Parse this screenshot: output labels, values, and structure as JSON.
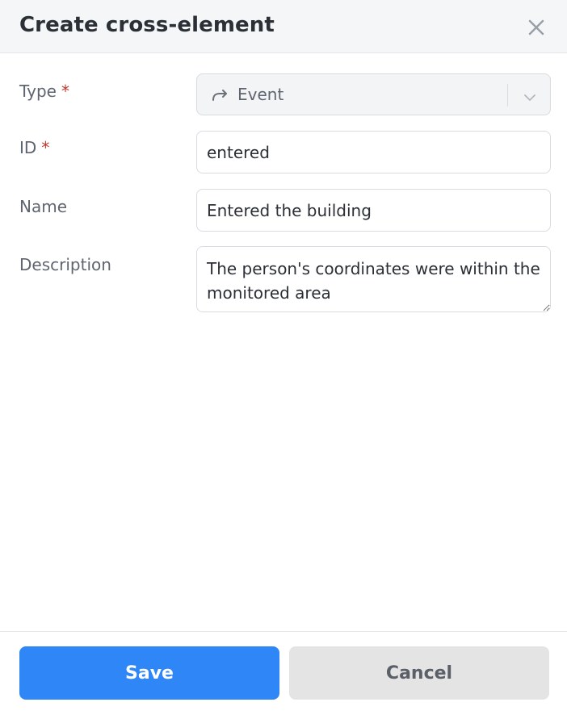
{
  "dialog": {
    "title": "Create cross-element",
    "close_icon": "close-icon"
  },
  "form": {
    "type": {
      "label": "Type",
      "required_marker": "*",
      "value": "Event",
      "icon": "redo-arrow-icon"
    },
    "id": {
      "label": "ID",
      "required_marker": "*",
      "value": "entered"
    },
    "name": {
      "label": "Name",
      "value": "Entered the building"
    },
    "description": {
      "label": "Description",
      "value": "The person's coordinates were within the monitored area"
    }
  },
  "footer": {
    "save_label": "Save",
    "cancel_label": "Cancel"
  },
  "colors": {
    "primary": "#2f86f6",
    "required": "#c0392b",
    "header_bg": "#f5f6f8",
    "cancel_bg": "#e4e4e5"
  }
}
